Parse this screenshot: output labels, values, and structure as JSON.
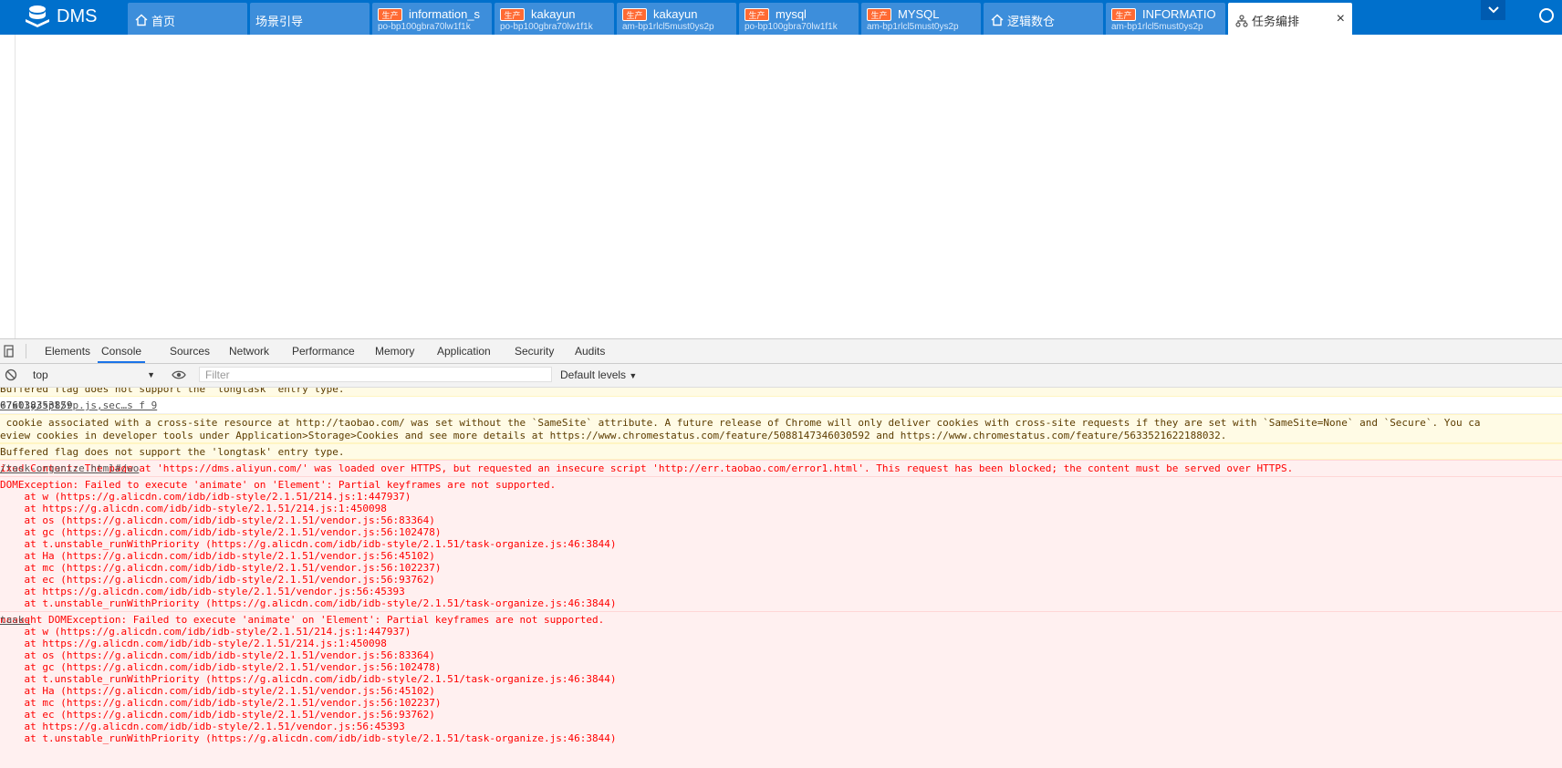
{
  "app": {
    "name": "DMS"
  },
  "tabs": [
    {
      "title": "首页",
      "sub": "",
      "badge": ""
    },
    {
      "title": "场景引导",
      "sub": "",
      "badge": ""
    },
    {
      "title": "information_s",
      "sub": "po-bp100gbra70lw1f1k",
      "badge": "生产"
    },
    {
      "title": "kakayun",
      "sub": "po-bp100gbra70lw1f1k",
      "badge": "生产"
    },
    {
      "title": "kakayun",
      "sub": "am-bp1rlcl5must0ys2p",
      "badge": "生产"
    },
    {
      "title": "mysql",
      "sub": "po-bp100gbra70lw1f1k",
      "badge": "生产"
    },
    {
      "title": "MYSQL",
      "sub": "am-bp1rlcl5must0ys2p",
      "badge": "生产"
    },
    {
      "title": "逻辑数仓",
      "sub": "",
      "badge": ""
    },
    {
      "title": "INFORMATIO",
      "sub": "am-bp1rlcl5must0ys2p",
      "badge": "生产"
    },
    {
      "title": "任务编排",
      "sub": "",
      "badge": ""
    }
  ],
  "devtools": {
    "tabs": [
      "Elements",
      "Console",
      "Sources",
      "Network",
      "Performance",
      "Memory",
      "Application",
      "Security",
      "Audits"
    ],
    "context": "top",
    "filter_placeholder": "Filter",
    "levels": "Default levels"
  },
  "console": {
    "warn1": "Buffered flag does not support the 'longtask' entry type.",
    "log1": "676038353859",
    "log1_src": "??xlly/spl/rp.js,sec…s f 9",
    "cookie_l1": " cookie associated with a cross-site resource at http://taobao.com/ was set without the `SameSite` attribute. A future release of Chrome will only deliver cookies with cross-site requests if they are set with `SameSite=None` and `Secure`. You ca",
    "cookie_l2": "eview cookies in developer tools under Application>Storage>Cookies and see more details at https://www.chromestatus.com/feature/5088147346030592 and https://www.chromestatus.com/feature/5633521622188032.",
    "warn2": "Buffered flag does not support the 'longtask' entry type.",
    "mixed": "ixed Content: The page at 'https://dms.aliyun.com/' was loaded over HTTPS, but requested an insecure script 'http://err.taobao.com/error1.html'. This request has been blocked; the content must be served over HTTPS.",
    "mixed_src": "/task-organize.html#/wo",
    "err1_head": "DOMException: Failed to execute 'animate' on 'Element': Partial keyframes are not supported.",
    "err2_head": "ncaught DOMException: Failed to execute 'animate' on 'Element': Partial keyframes are not supported.",
    "err2_src": "task-",
    "stack": [
      "    at w (https://g.alicdn.com/idb/idb-style/2.1.51/214.js:1:447937)",
      "    at https://g.alicdn.com/idb/idb-style/2.1.51/214.js:1:450098",
      "    at os (https://g.alicdn.com/idb/idb-style/2.1.51/vendor.js:56:83364)",
      "    at gc (https://g.alicdn.com/idb/idb-style/2.1.51/vendor.js:56:102478)",
      "    at t.unstable_runWithPriority (https://g.alicdn.com/idb/idb-style/2.1.51/task-organize.js:46:3844)",
      "    at Ha (https://g.alicdn.com/idb/idb-style/2.1.51/vendor.js:56:45102)",
      "    at mc (https://g.alicdn.com/idb/idb-style/2.1.51/vendor.js:56:102237)",
      "    at ec (https://g.alicdn.com/idb/idb-style/2.1.51/vendor.js:56:93762)",
      "    at https://g.alicdn.com/idb/idb-style/2.1.51/vendor.js:56:45393",
      "    at t.unstable_runWithPriority (https://g.alicdn.com/idb/idb-style/2.1.51/task-organize.js:46:3844)"
    ]
  },
  "colors": {
    "brand": "#0070cc",
    "tab": "#3d8edb",
    "badge": "#ff6a33",
    "error": "#ff0000"
  }
}
